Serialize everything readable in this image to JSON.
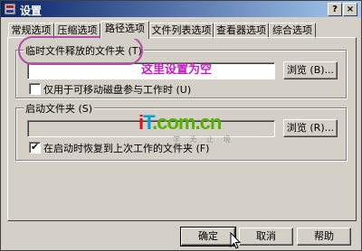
{
  "window": {
    "title": "设置",
    "help_glyph": "?",
    "close_glyph": "×"
  },
  "tabs": [
    {
      "label": "常规选项",
      "active": false
    },
    {
      "label": "压缩选项",
      "active": false
    },
    {
      "label": "路径选项",
      "active": true
    },
    {
      "label": "文件列表选项",
      "active": false
    },
    {
      "label": "查看器选项",
      "active": false
    },
    {
      "label": "综合选项",
      "active": false
    }
  ],
  "temp_folder": {
    "label": "临时文件释放的文件夹 (T)",
    "value": "",
    "browse_label": "浏览 (B)...",
    "checkbox_label": "仅用于可移动磁盘参与工作时 (U)",
    "checkbox_checked": false
  },
  "startup_folder": {
    "label": "启动文件夹 (S)",
    "value": "",
    "browse_label": "浏览 (R)...",
    "checkbox_label": "在启动时恢复到上次工作的文件夹 (F)",
    "checkbox_checked": true
  },
  "annotation": {
    "text": "这里设置为空",
    "color": "#c020c0"
  },
  "watermark": {
    "main_i": "i",
    "main_t": "T",
    "main_rest": ".com.cn",
    "sub": "学 无 止 境"
  },
  "footer": {
    "ok_label": "确定",
    "cancel_label": "取消",
    "help_label": "帮助"
  },
  "colors": {
    "title_start": "#0a246a",
    "title_end": "#a6caf0",
    "face": "#d4d0c8"
  }
}
